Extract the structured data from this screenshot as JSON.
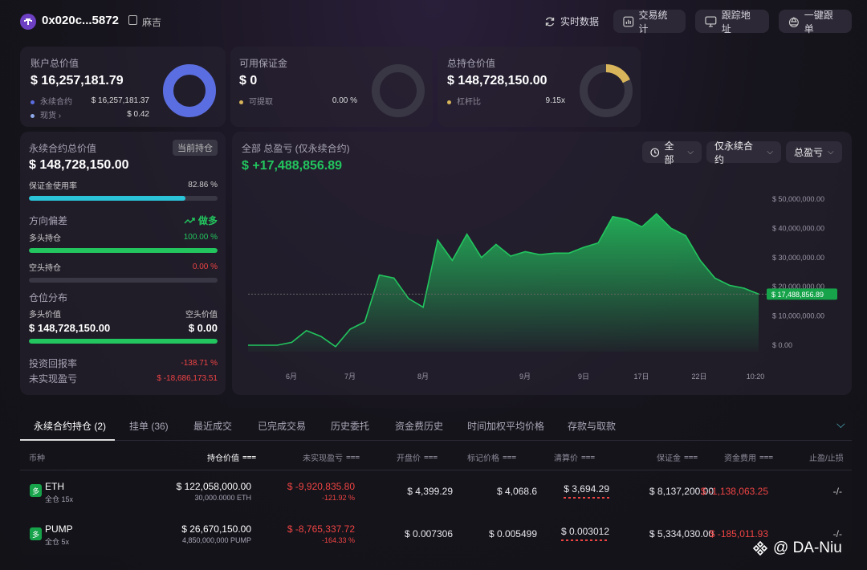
{
  "header": {
    "address": "0x020c...5872",
    "tag": "麻吉",
    "realtime": "实时数据",
    "stats": "交易统计",
    "track": "跟踪地址",
    "copy": "一键跟单"
  },
  "summary": {
    "account": {
      "title": "账户总价值",
      "value": "$ 16,257,181.79",
      "rows": [
        {
          "label": "永续合约",
          "value": "$ 16,257,181.37"
        },
        {
          "label": "现货",
          "value": "$ 0.42"
        }
      ]
    },
    "margin": {
      "title": "可用保证金",
      "value": "$ 0",
      "row": {
        "label": "可提取",
        "value": "0.00 %"
      }
    },
    "position": {
      "title": "总持仓价值",
      "value": "$ 148,728,150.00",
      "row": {
        "label": "杠杆比",
        "value": "9.15x"
      }
    }
  },
  "colors": {
    "perp": "#5b6ee1",
    "spot": "#8ea8e8",
    "withdraw": "#d8b45a",
    "leverage": "#d8b45a",
    "profit": "#22c55e",
    "loss": "#ef4444"
  },
  "donuts": {
    "account_perp_fraction": 1.0,
    "margin_fraction": 0.0,
    "leverage_fraction": 0.18
  },
  "left_panel": {
    "title": "永续合约总价值",
    "current_badge": "当前持仓",
    "value": "$ 148,728,150.00",
    "margin_usage": {
      "label": "保证金使用率",
      "value": "82.86 %",
      "fraction": 0.8286
    },
    "bias": {
      "label": "方向偏差",
      "value": "做多",
      "long": {
        "label": "多头持仓",
        "value": "100.00 %",
        "fraction": 1.0
      },
      "short": {
        "label": "空头持仓",
        "value": "0.00 %",
        "fraction": 0.0
      }
    },
    "distribution": {
      "label": "仓位分布",
      "long_label": "多头价值",
      "short_label": "空头价值",
      "long_value": "$ 148,728,150.00",
      "short_value": "$ 0.00",
      "fraction": 1.0
    },
    "roi": {
      "label": "投资回报率",
      "value": "-138.71 %"
    },
    "unrealized": {
      "label": "未实现盈亏",
      "value": "$ -18,686,173.51"
    }
  },
  "pnl_panel": {
    "title": "全部 总盈亏 (仅永续合约)",
    "value": "$ +17,488,856.89",
    "filters": [
      "全部",
      "仅永续合约",
      "总盈亏"
    ]
  },
  "chart_data": {
    "type": "area",
    "x_ticks": [
      "6月",
      "7月",
      "8月",
      "9月",
      "9日",
      "17日",
      "22日",
      "10:20"
    ],
    "y_ticks": [
      "$ 50,000,000.00",
      "$ 40,000,000.00",
      "$ 30,000,000.00",
      "$ 20,000,000.00",
      "$ 10,000,000.00",
      "$ 0.00"
    ],
    "ylim": [
      0,
      50000000
    ],
    "current_label": "$ 17,488,856.89",
    "current_value": 17488856.89,
    "values": [
      0,
      0,
      0,
      1000000,
      5000000,
      3000000,
      -500000,
      5500000,
      8000000,
      24000000,
      23000000,
      16000000,
      13000000,
      36000000,
      29000000,
      38000000,
      30000000,
      34500000,
      30500000,
      32000000,
      31000000,
      31500000,
      31500000,
      33500000,
      35000000,
      44000000,
      43000000,
      40500000,
      45000000,
      40000000,
      37500000,
      29000000,
      23000000,
      20500000,
      19500000,
      17488856.89
    ]
  },
  "tabs": [
    "永续合约持仓 (2)",
    "挂单 (36)",
    "最近成交",
    "已完成交易",
    "历史委托",
    "资金费历史",
    "时间加权平均价格",
    "存款与取款"
  ],
  "table": {
    "headers": [
      "币种",
      "持仓价值",
      "未实现盈亏",
      "开盘价",
      "标记价格",
      "清算价",
      "保证金",
      "资金费用",
      "止盈/止损"
    ],
    "rows": [
      {
        "badge": "多",
        "coin": "ETH",
        "mode": "全仓 15x",
        "value": "$ 122,058,000.00",
        "size": "30,000.0000 ETH",
        "pnl": "$ -9,920,835.80",
        "pnl_pct": "-121.92 %",
        "entry": "$ 4,399.29",
        "mark": "$ 4,068.6",
        "liq": "$ 3,694.29",
        "margin": "$ 8,137,200.00",
        "funding": "$ -1,138,063.25",
        "tpsl": "-/-"
      },
      {
        "badge": "多",
        "coin": "PUMP",
        "mode": "全仓 5x",
        "value": "$ 26,670,150.00",
        "size": "4,850,000,000 PUMP",
        "pnl": "$ -8,765,337.72",
        "pnl_pct": "-164.33 %",
        "entry": "$ 0.007306",
        "mark": "$ 0.005499",
        "liq": "$ 0.003012",
        "margin": "$ 5,334,030.00",
        "funding": "$ -185,011.93",
        "tpsl": "-/-"
      }
    ]
  },
  "watermark": "@ DA-Niu"
}
